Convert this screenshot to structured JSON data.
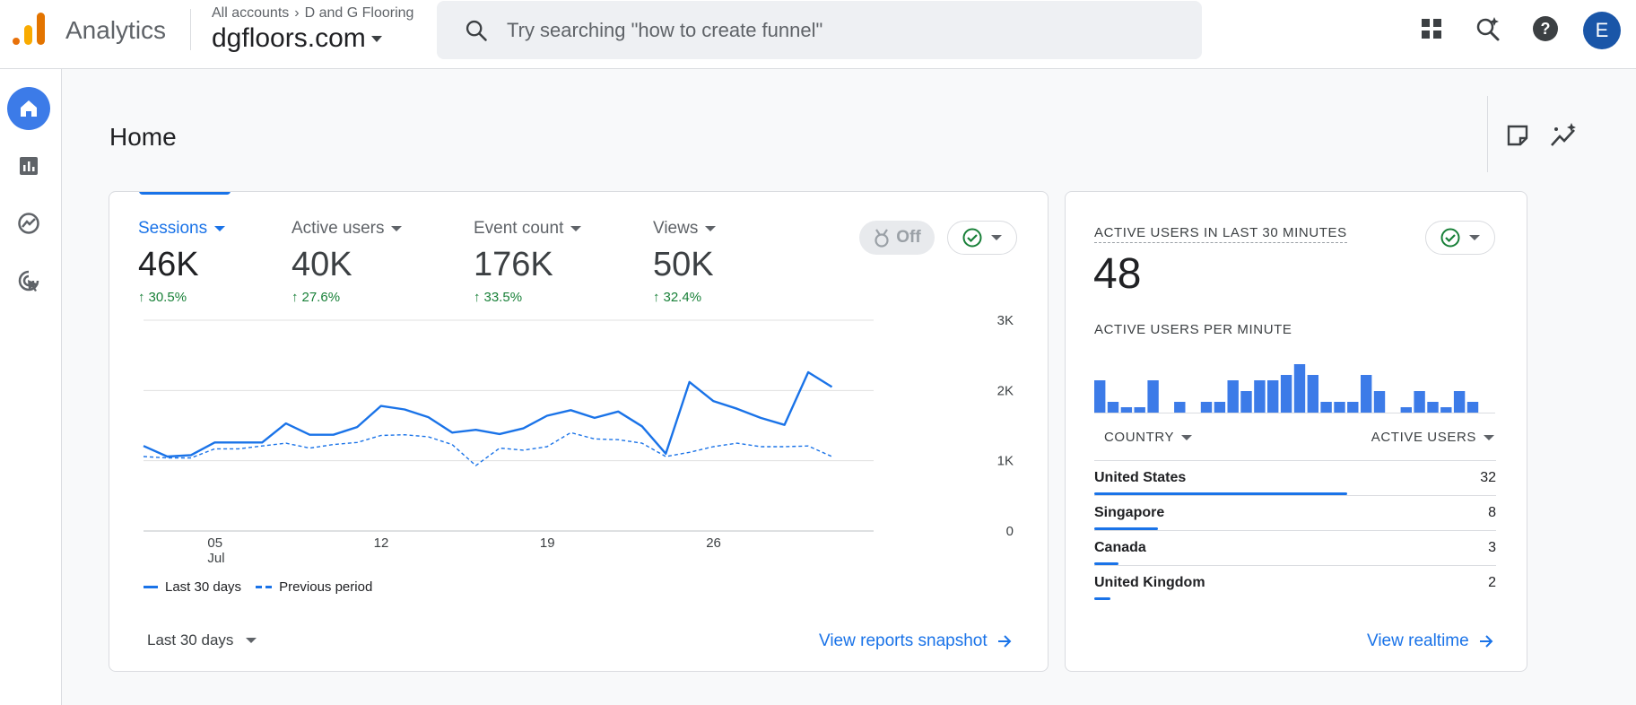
{
  "app": {
    "name": "Analytics",
    "breadcrumb": [
      "All accounts",
      "D and G Flooring"
    ],
    "property": "dgfloors.com",
    "avatar_letter": "E"
  },
  "search": {
    "placeholder": "Try searching \"how to create funnel\""
  },
  "topbar_icons": [
    "apps-grid-icon",
    "search-insights-icon",
    "help-icon"
  ],
  "leftnav": [
    "home-icon",
    "reports-icon",
    "explore-icon",
    "advertising-icon"
  ],
  "page": {
    "title": "Home"
  },
  "header_icons": [
    "notes-icon",
    "insights-icon"
  ],
  "overview": {
    "metrics": [
      {
        "label": "Sessions",
        "value": "46K",
        "delta": "30.5%",
        "active": true
      },
      {
        "label": "Active users",
        "value": "40K",
        "delta": "27.6%",
        "active": false
      },
      {
        "label": "Event count",
        "value": "176K",
        "delta": "33.5%",
        "active": false
      },
      {
        "label": "Views",
        "value": "50K",
        "delta": "32.4%",
        "active": false
      }
    ],
    "benchmark_toggle": "Off",
    "legend": {
      "current": "Last 30 days",
      "previous": "Previous period"
    },
    "date_range": "Last 30 days",
    "link": "View reports snapshot"
  },
  "chart_data": {
    "type": "line",
    "x": [
      "Jul 02",
      "Jul 03",
      "Jul 04",
      "Jul 05",
      "Jul 06",
      "Jul 07",
      "Jul 08",
      "Jul 09",
      "Jul 10",
      "Jul 11",
      "Jul 12",
      "Jul 13",
      "Jul 14",
      "Jul 15",
      "Jul 16",
      "Jul 17",
      "Jul 18",
      "Jul 19",
      "Jul 20",
      "Jul 21",
      "Jul 22",
      "Jul 23",
      "Jul 24",
      "Jul 25",
      "Jul 26",
      "Jul 27",
      "Jul 28",
      "Jul 29",
      "Jul 30",
      "Jul 31",
      "Aug 01"
    ],
    "x_ticks": [
      {
        "index": 3,
        "label": "05",
        "sublabel": "Jul"
      },
      {
        "index": 10,
        "label": "12",
        "sublabel": ""
      },
      {
        "index": 17,
        "label": "19",
        "sublabel": ""
      },
      {
        "index": 24,
        "label": "26",
        "sublabel": ""
      }
    ],
    "y_ticks": [
      "0",
      "1K",
      "2K",
      "3K"
    ],
    "ylim": [
      0,
      3000
    ],
    "series": [
      {
        "name": "Last 30 days",
        "style": "solid",
        "values": [
          1210,
          1060,
          1080,
          1260,
          1260,
          1260,
          1530,
          1370,
          1370,
          1480,
          1780,
          1730,
          1620,
          1400,
          1440,
          1380,
          1460,
          1640,
          1720,
          1610,
          1700,
          1490,
          1100,
          2120,
          1850,
          1740,
          1610,
          1510,
          2260,
          2050
        ]
      },
      {
        "name": "Previous period",
        "style": "dashed",
        "values": [
          1060,
          1040,
          1040,
          1170,
          1170,
          1210,
          1250,
          1180,
          1230,
          1260,
          1360,
          1370,
          1340,
          1230,
          930,
          1180,
          1150,
          1200,
          1400,
          1310,
          1300,
          1250,
          1060,
          1120,
          1200,
          1250,
          1200,
          1200,
          1210,
          1060
        ]
      }
    ],
    "color": "#1a73e8"
  },
  "realtime": {
    "title": "ACTIVE USERS IN LAST 30 MINUTES",
    "value": "48",
    "per_minute_label": "ACTIVE USERS PER MINUTE",
    "per_minute": [
      3,
      1,
      0.5,
      0.5,
      3,
      0,
      1,
      0,
      1,
      1,
      3,
      2,
      3,
      3,
      3.5,
      4.5,
      3.5,
      1,
      1,
      1,
      3.5,
      2,
      0,
      0.5,
      2,
      1,
      0.5,
      2,
      1
    ],
    "col_country": "COUNTRY",
    "col_users": "ACTIVE USERS",
    "rows": [
      {
        "country": "United States",
        "users": "32",
        "share": 1.0
      },
      {
        "country": "Singapore",
        "users": "8",
        "share": 0.25
      },
      {
        "country": "Canada",
        "users": "3",
        "share": 0.094
      },
      {
        "country": "United Kingdom",
        "users": "2",
        "share": 0.063
      }
    ],
    "link": "View realtime"
  }
}
